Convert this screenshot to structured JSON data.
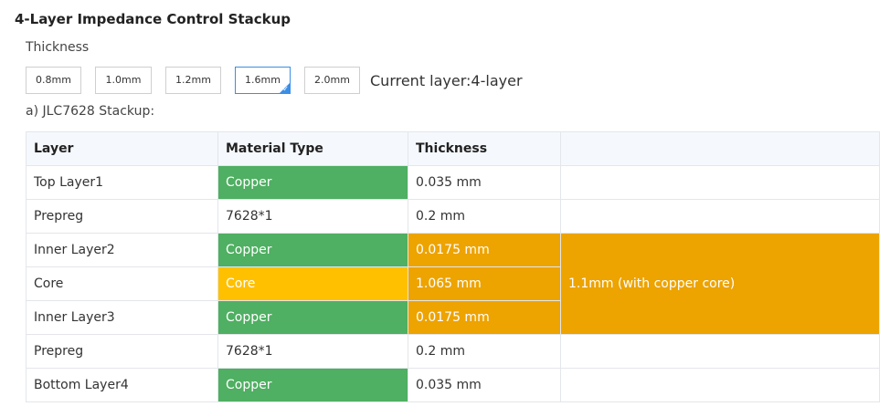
{
  "title": "4-Layer Impedance Control Stackup",
  "thickness_label": "Thickness",
  "thickness_options": [
    "0.8mm",
    "1.0mm",
    "1.2mm",
    "1.6mm",
    "2.0mm"
  ],
  "selected_thickness": "1.6mm",
  "current_layer_text": "Current layer:4-layer",
  "stackup_label": "a) JLC7628 Stackup:",
  "table": {
    "headers": [
      "Layer",
      "Material Type",
      "Thickness",
      ""
    ],
    "rows": [
      {
        "layer": "Top Layer1",
        "material": "Copper",
        "thickness": "0.035 mm"
      },
      {
        "layer": "Prepreg",
        "material": "7628*1",
        "thickness": "0.2 mm"
      },
      {
        "layer": "Inner Layer2",
        "material": "Copper",
        "thickness": "0.0175 mm"
      },
      {
        "layer": "Core",
        "material": "Core",
        "thickness": "1.065 mm"
      },
      {
        "layer": "Inner Layer3",
        "material": "Copper",
        "thickness": "0.0175 mm"
      },
      {
        "layer": "Prepreg",
        "material": "7628*1",
        "thickness": "0.2 mm"
      },
      {
        "layer": "Bottom Layer4",
        "material": "Copper",
        "thickness": "0.035 mm"
      }
    ],
    "merged_note": "1.1mm (with copper core)"
  },
  "colors": {
    "copper": "#4faf62",
    "core": "#ffc000",
    "core_group": "#eda300",
    "selected_border": "#3a8ee6"
  },
  "icons": {
    "selected_check": "✓"
  }
}
